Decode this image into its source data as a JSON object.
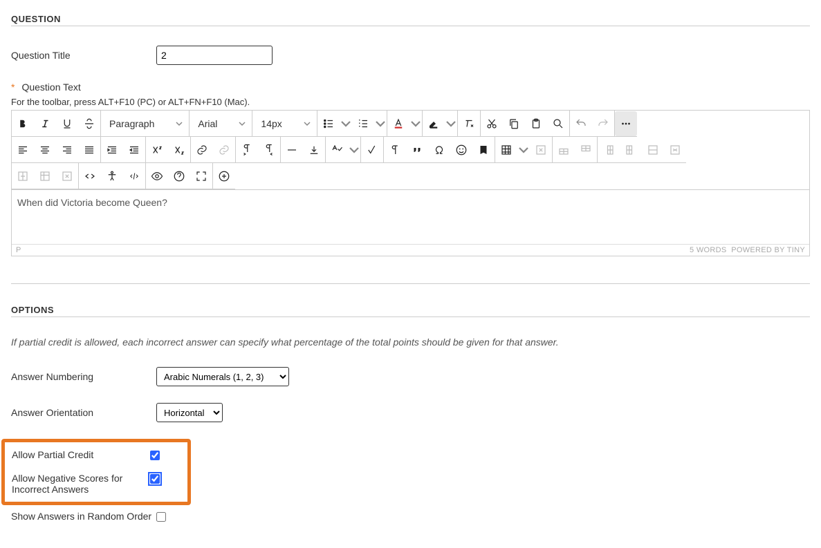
{
  "question_section": {
    "header": "QUESTION",
    "title_label": "Question Title",
    "title_value": "2",
    "text_label": "Question Text",
    "required_marker": "*",
    "toolbar_hint": "For the toolbar, press ALT+F10 (PC) or ALT+FN+F10 (Mac).",
    "editor_content": "When did Victoria become Queen?",
    "path_display": "P",
    "word_count": "5 WORDS",
    "powered_by": "POWERED BY TINY"
  },
  "toolbar_selects": {
    "block_format": "Paragraph",
    "font_family": "Arial",
    "font_size": "14px"
  },
  "options_section": {
    "header": "OPTIONS",
    "note": "If partial credit is allowed, each incorrect answer can specify what percentage of the total points should be given for that answer.",
    "numbering_label": "Answer Numbering",
    "numbering_value": "Arabic Numerals (1, 2, 3)",
    "orientation_label": "Answer Orientation",
    "orientation_value": "Horizontal",
    "partial_credit_label": "Allow Partial Credit",
    "negative_scores_label": "Allow Negative Scores for Incorrect Answers",
    "random_order_label": "Show Answers in Random Order"
  }
}
